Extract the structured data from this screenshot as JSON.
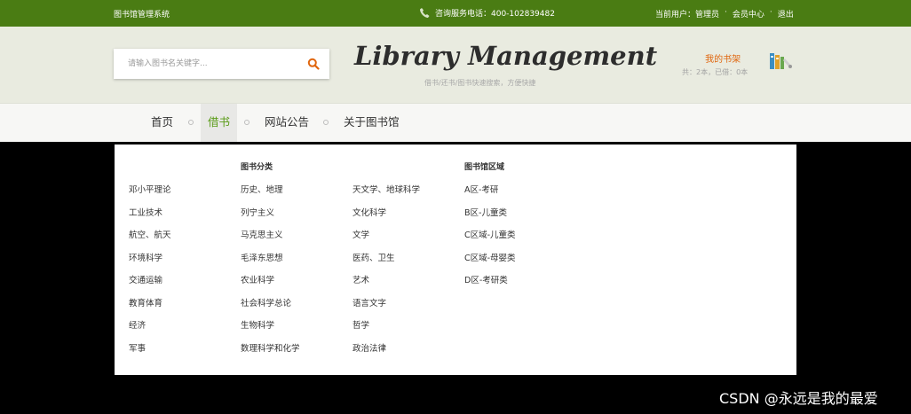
{
  "topbar": {
    "site_name": "图书馆管理系统",
    "hotline": "咨询服务电话：400-102839482",
    "current_user_label": "当前用户：",
    "user_name": "管理员",
    "dot": "·",
    "member_center": "会员中心",
    "logout": "退出"
  },
  "header": {
    "search_placeholder": "请输入图书名关键字...",
    "logo_text": "Library Management",
    "tagline": "借书/还书/图书快速搜索，方便快捷",
    "shelf_title": "我的书架",
    "shelf_counts": "共：2本，已借：0本"
  },
  "nav": {
    "items": [
      {
        "label": "首页"
      },
      {
        "label": "借书"
      },
      {
        "label": "网站公告"
      },
      {
        "label": "关于图书馆"
      }
    ]
  },
  "dropdown": {
    "category_heading": "图书分类",
    "area_heading": "图书馆区域",
    "col1": [
      "邓小平理论",
      "工业技术",
      "航空、航天",
      "环境科学",
      "交通运输",
      "教育体育",
      "经济",
      "军事"
    ],
    "col2": [
      "历史、地理",
      "列宁主义",
      "马克思主义",
      "毛泽东思想",
      "农业科学",
      "社会科学总论",
      "生物科学",
      "数理科学和化学"
    ],
    "col3": [
      "天文学、地球科学",
      "文化科学",
      "文学",
      "医药、卫生",
      "艺术",
      "语言文字",
      "哲学",
      "政治法律"
    ],
    "col4": [
      "A区-考研",
      "B区-儿童类",
      "C区域-儿童类",
      "C区域-母婴类",
      "D区-考研类"
    ]
  },
  "watermark": "CSDN @永远是我的最爱",
  "colors": {
    "topbar_bg": "#4a7c13",
    "nav_active": "#5a9b18",
    "shelf_title": "#e0660e",
    "search_icon": "#e0660e"
  },
  "icons": [
    "phone-icon",
    "search-icon",
    "bookshelf-icon"
  ]
}
